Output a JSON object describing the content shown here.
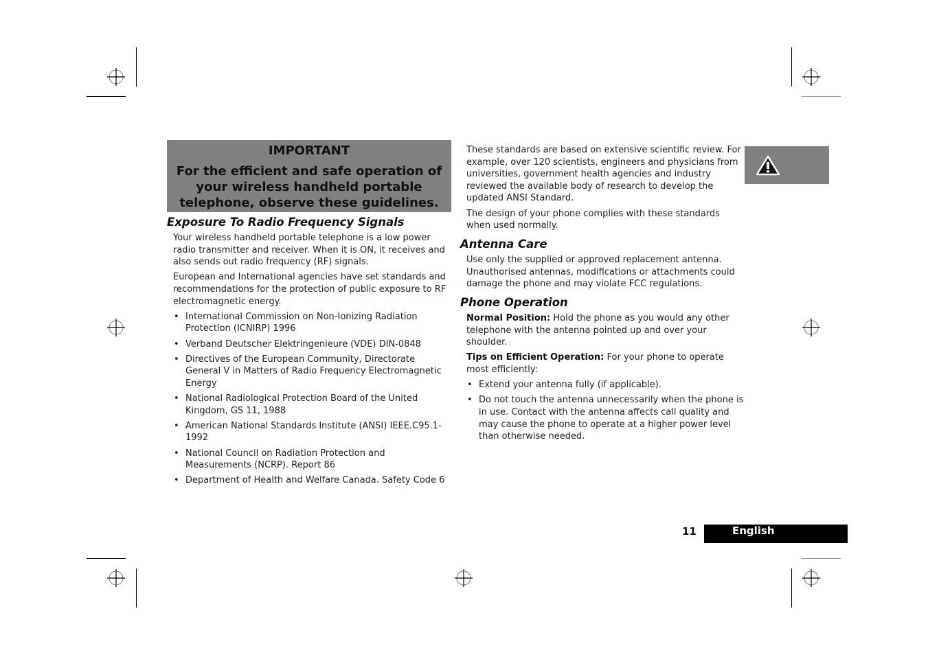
{
  "important": {
    "title": "IMPORTANT",
    "body": "For the efficient and safe operation of your wireless handheld portable telephone, observe these guidelines."
  },
  "left_column": {
    "heading": "Exposure To Radio Frequency Signals",
    "paragraphs": [
      "Your wireless handheld portable telephone is a low power radio transmitter and receiver. When it is ON, it receives and also sends out radio frequency (RF) signals.",
      "European and International agencies have set standards and recommendations for the protection of public exposure to RF electromagnetic energy."
    ],
    "bullets": [
      "International Commission on Non-Ionizing Radiation Protection (ICNIRP) 1996",
      "Verband Deutscher Elektringenieure (VDE) DIN-0848",
      "Directives of the European Community, Directorate General V in Matters of Radio Frequency Electromagnetic Energy",
      "National Radiological Protection Board of the United Kingdom, GS 11, 1988",
      "American National Standards Institute (ANSI) IEEE.C95.1-1992",
      "National Council on Radiation Protection and Measurements (NCRP). Report 86",
      "Department of Health and Welfare Canada. Safety Code 6"
    ]
  },
  "right_column": {
    "intro_paragraphs": [
      "These standards are based on extensive scientific review. For example, over 120 scientists, engineers and physicians from universities, government health agencies and industry reviewed the available body of research to develop the updated ANSI Standard.",
      "The design of your phone complies with these standards when used normally."
    ],
    "antenna_care": {
      "heading": "Antenna Care",
      "text": "Use only the supplied or approved replacement antenna. Unauthorised antennas, modifications or attachments could damage the phone and may violate FCC regulations."
    },
    "phone_operation": {
      "heading": "Phone Operation",
      "normal_position_label": "Normal Position:",
      "normal_position_text": " Hold the phone as you would any other telephone with the antenna pointed up and over your shoulder.",
      "tips_label": "Tips on Efficient Operation:",
      "tips_text": " For your phone to operate most efficiently:",
      "bullets": [
        "Extend your antenna fully (if applicable).",
        "Do not touch the antenna unnecessarily when the phone is in use. Contact with the antenna affects call quality and may cause the phone to operate at a higher power level than otherwise needed."
      ]
    }
  },
  "side_tab": {
    "icon": "warning-icon"
  },
  "footer": {
    "page_number": "11",
    "language": "English"
  },
  "colors": {
    "box_grey": "#808080",
    "footer_bar": "#000000",
    "footer_text": "#ffffff"
  }
}
